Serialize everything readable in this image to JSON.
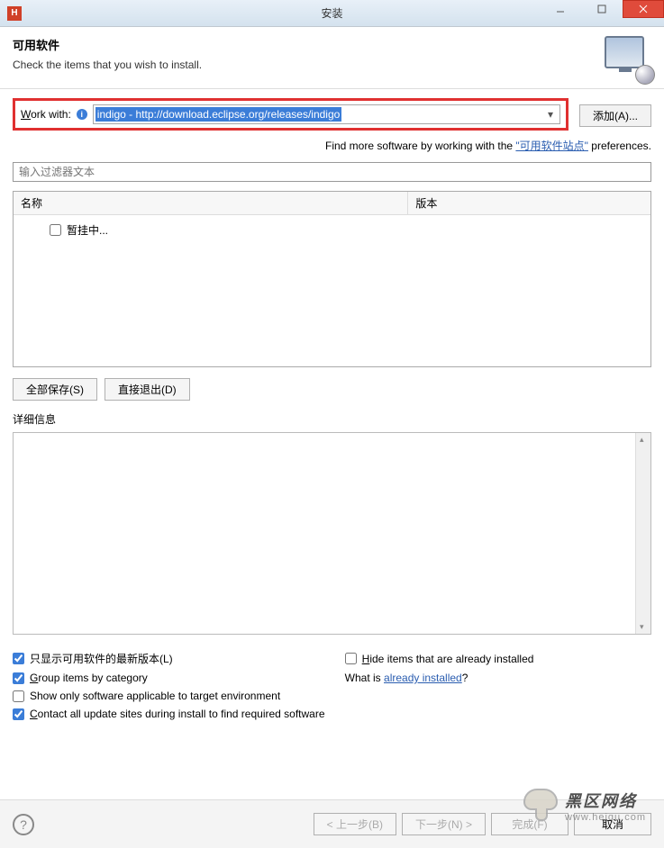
{
  "window": {
    "app_icon_letter": "H",
    "title": "安装"
  },
  "header": {
    "title": "可用软件",
    "subtitle": "Check the items that you wish to install."
  },
  "workwith": {
    "label_pre": "W",
    "label_post": "ork with:",
    "value": "indigo - http://download.eclipse.org/releases/indigo",
    "add_button": "添加(A)..."
  },
  "hint": {
    "prefix": "Find more software by working with the ",
    "link": "\"可用软件站点\"",
    "suffix": " preferences."
  },
  "filter_placeholder": "输入过滤器文本",
  "tree": {
    "col_name": "名称",
    "col_version": "版本",
    "pending_item": "暂挂中..."
  },
  "buttons": {
    "save_all": "全部保存(S)",
    "quit": "直接退出(D)"
  },
  "details_label": "详细信息",
  "options": {
    "latest_only": "只显示可用软件的最新版本(L)",
    "hide_installed": "Hide items that are already installed",
    "group_by_cat": "Group items by category",
    "what_is_prefix": "What is ",
    "already_installed_link": "already installed",
    "what_is_suffix": "?",
    "target_env": "Show only software applicable to target environment",
    "contact_sites": "Contact all update sites during install to find required software"
  },
  "footer": {
    "back": "< 上一步(B)",
    "next": "下一步(N) >",
    "finish": "完成(F)",
    "cancel": "取消"
  },
  "watermark": {
    "text": "黑区网络",
    "url": "www.heiqu.com"
  }
}
